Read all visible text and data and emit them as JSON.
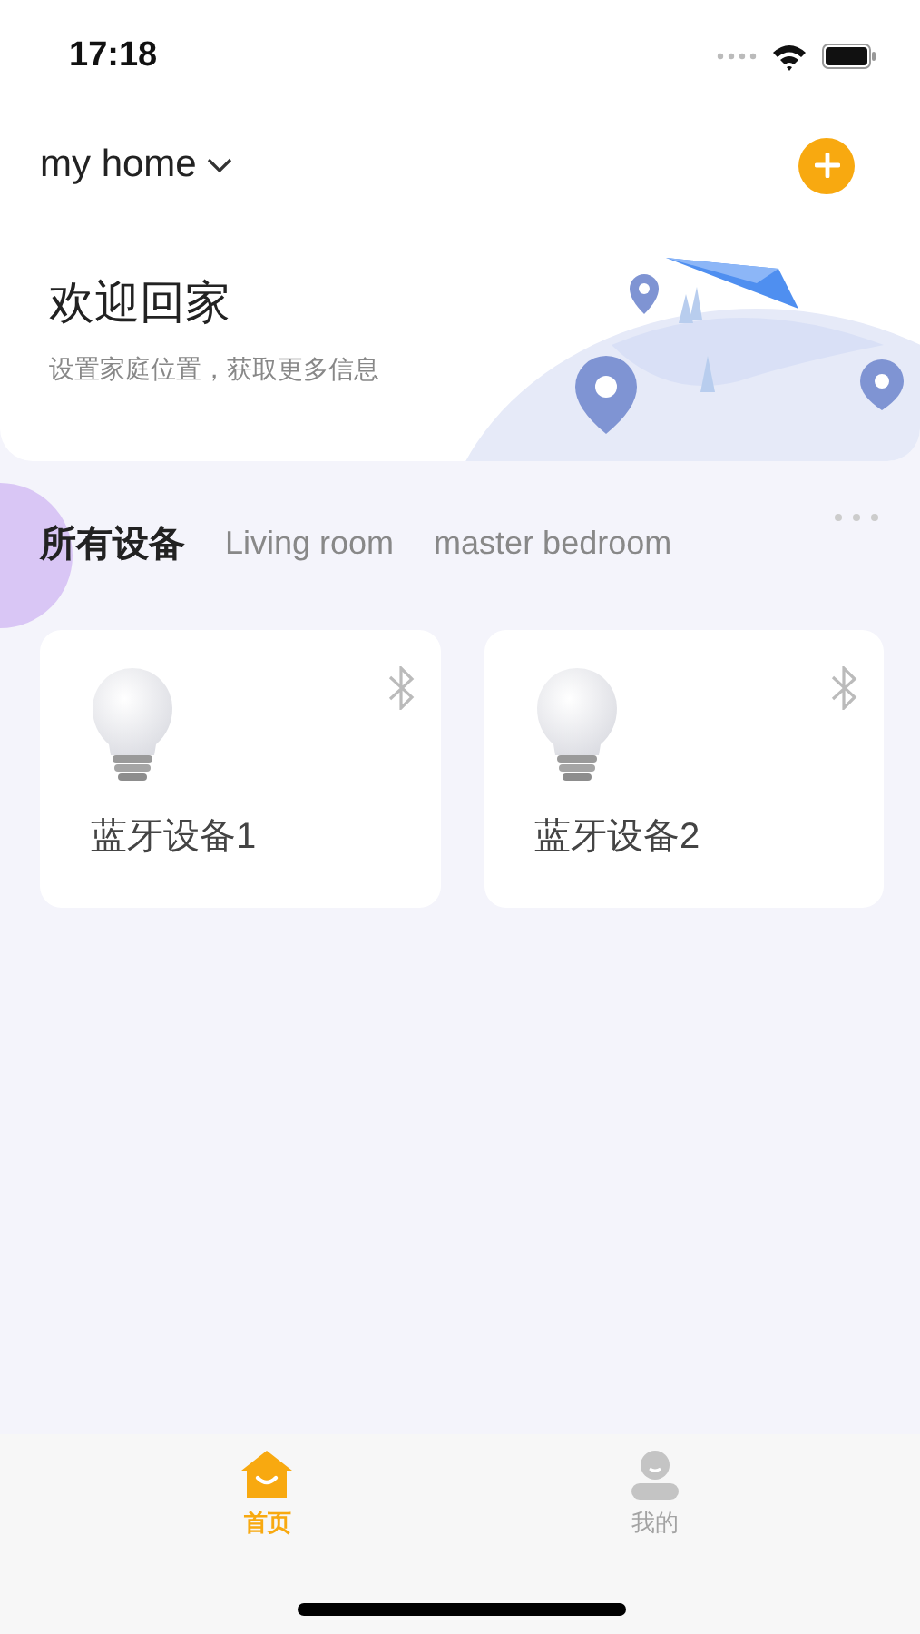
{
  "status_bar": {
    "time": "17:18"
  },
  "header": {
    "home_name": "my home"
  },
  "welcome": {
    "title": "欢迎回家",
    "subtitle": "设置家庭位置，获取更多信息"
  },
  "rooms": [
    {
      "label": "所有设备",
      "selected": true
    },
    {
      "label": "Living room",
      "selected": false
    },
    {
      "label": "master bedroom",
      "selected": false
    }
  ],
  "devices": [
    {
      "name": "蓝牙设备1"
    },
    {
      "name": "蓝牙设备2"
    }
  ],
  "tab_bar": [
    {
      "label": "首页",
      "kind": "home",
      "selected": true
    },
    {
      "label": "我的",
      "kind": "profile",
      "selected": false
    }
  ]
}
